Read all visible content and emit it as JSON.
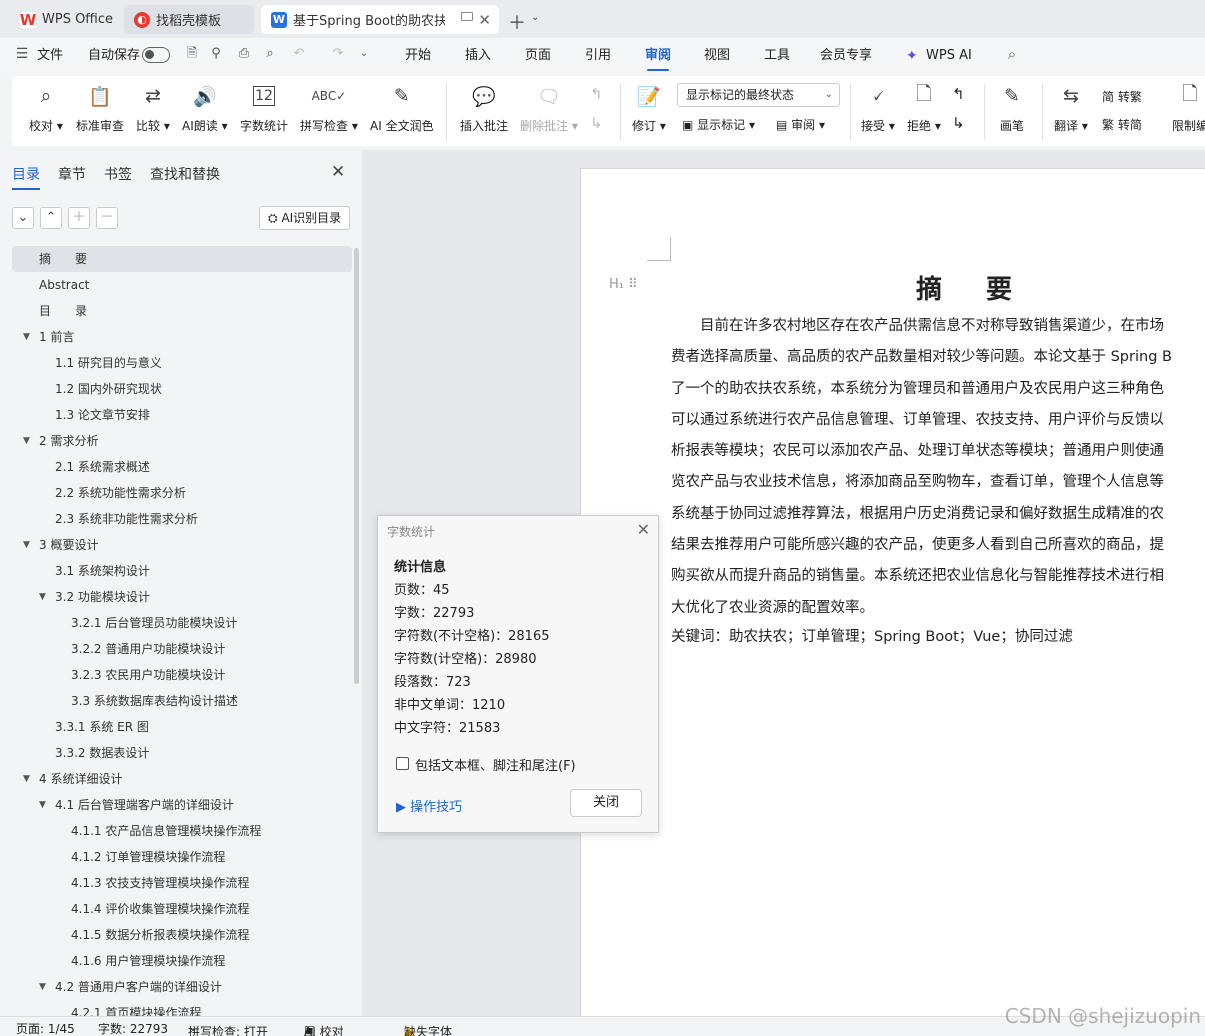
{
  "tabs": [
    {
      "label": "WPS Office",
      "icon": "wps-logo-icon",
      "color": "#e8382f"
    },
    {
      "label": "找稻壳模板",
      "icon": "docer-icon",
      "color": "#e8382f"
    },
    {
      "label": "基于Spring Boot的助农扶农",
      "icon": "word-doc-icon",
      "color": "#2b6fe0"
    }
  ],
  "menu": {
    "file": "文件",
    "autosave": "自动保存",
    "items": [
      "开始",
      "插入",
      "页面",
      "引用",
      "审阅",
      "视图",
      "工具",
      "会员专享",
      "WPS AI"
    ],
    "selected": "审阅"
  },
  "ribbon": {
    "proofread": "校对",
    "std_review": "标准审查",
    "compare": "比较",
    "ai_read": "AI朗读",
    "word_count": "字数统计",
    "spell_check": "拼写检查",
    "ai_polish": "AI 全文润色",
    "insert_comment": "插入批注",
    "delete_comment": "删除批注",
    "revise": "修订",
    "markup_state": "显示标记的最终状态",
    "show_markup": "显示标记",
    "review_pane": "审阅",
    "accept": "接受",
    "reject": "拒绝",
    "pen": "画笔",
    "translate": "翻译",
    "to_trad": "简 转繁",
    "to_simp": "繁 转简",
    "restrict": "限制编"
  },
  "nav": {
    "tabs": [
      "目录",
      "章节",
      "书签",
      "查找和替换"
    ],
    "ai_toc": "AI识别目录",
    "items": [
      {
        "label": "摘　　要",
        "level": 0,
        "selected": true
      },
      {
        "label": "Abstract",
        "level": 0
      },
      {
        "label": "目　　录",
        "level": 0
      },
      {
        "label": "1  前言",
        "level": 0,
        "expand": true
      },
      {
        "label": "1.1  研究目的与意义",
        "level": 1
      },
      {
        "label": "1.2  国内外研究现状",
        "level": 1
      },
      {
        "label": "1.3  论文章节安排",
        "level": 1
      },
      {
        "label": "2  需求分析",
        "level": 0,
        "expand": true
      },
      {
        "label": "2.1  系统需求概述",
        "level": 1
      },
      {
        "label": "2.2  系统功能性需求分析",
        "level": 1
      },
      {
        "label": "2.3  系统非功能性需求分析",
        "level": 1
      },
      {
        "label": "3  概要设计",
        "level": 0,
        "expand": true
      },
      {
        "label": "3.1  系统架构设计",
        "level": 1
      },
      {
        "label": "3.2  功能模块设计",
        "level": 1,
        "expand": true
      },
      {
        "label": "3.2.1  后台管理员功能模块设计",
        "level": 2
      },
      {
        "label": "3.2.2  普通用户功能模块设计",
        "level": 2
      },
      {
        "label": "3.2.3  农民用户功能模块设计",
        "level": 2
      },
      {
        "label": "3.3  系统数据库表结构设计描述",
        "level": 2
      },
      {
        "label": "3.3.1  系统 ER 图",
        "level": 1
      },
      {
        "label": "3.3.2  数据表设计",
        "level": 1
      },
      {
        "label": "4  系统详细设计",
        "level": 0,
        "expand": true
      },
      {
        "label": "4.1  后台管理端客户端的详细设计",
        "level": 1,
        "expand": true
      },
      {
        "label": "4.1.1  农产品信息管理模块操作流程",
        "level": 2
      },
      {
        "label": "4.1.2  订单管理模块操作流程",
        "level": 2
      },
      {
        "label": "4.1.3  农技支持管理模块操作流程",
        "level": 2
      },
      {
        "label": "4.1.4  评价收集管理模块操作流程",
        "level": 2
      },
      {
        "label": "4.1.5  数据分析报表模块操作流程",
        "level": 2
      },
      {
        "label": "4.1.6  用户管理模块操作流程",
        "level": 2
      },
      {
        "label": "4.2  普通用户客户端的详细设计",
        "level": 1,
        "expand": true
      },
      {
        "label": "4.2.1  首页模块操作流程",
        "level": 2
      }
    ]
  },
  "document": {
    "heading_mark": "H₁",
    "title": "摘要",
    "lines": [
      "　　目前在许多农村地区存在农产品供需信息不对称导致销售渠道少，在市场",
      "费者选择高质量、高品质的农产品数量相对较少等问题。本论文基于 Spring B",
      "了一个的助农扶农系统，本系统分为管理员和普通用户及农民用户这三种角色",
      "可以通过系统进行农产品信息管理、订单管理、农技支持、用户评价与反馈以",
      "析报表等模块；农民可以添加农产品、处理订单状态等模块；普通用户则使通",
      "览农产品与农业技术信息，将添加商品至购物车，查看订单，管理个人信息等",
      "系统基于协同过滤推荐算法，根据用户历史消费记录和偏好数据生成精准的农",
      "结果去推荐用户可能所感兴趣的农产品，使更多人看到自己所喜欢的商品，提",
      "购买欲从而提升商品的销售量。本系统还把农业信息化与智能推荐技术进行相",
      "大优化了农业资源的配置效率。"
    ],
    "keywords": "关键词：助农扶农；订单管理；Spring Boot；Vue；协同过滤"
  },
  "dialog": {
    "title": "字数统计",
    "heading": "统计信息",
    "rows": [
      "页数：45",
      "字数：22793",
      "字符数(不计空格)：28165",
      "字符数(计空格)：28980",
      "段落数：723",
      "非中文单词：1210",
      "中文字符：21583"
    ],
    "checkbox": "包括文本框、脚注和尾注(F)",
    "tips": "操作技巧",
    "close": "关闭"
  },
  "status": {
    "page": "页面: 1/45",
    "words": "字数: 22793",
    "spell": "拼写检查: 打开",
    "ai_proof": "AI 校对",
    "missing_font": "缺失字体"
  },
  "watermark": "CSDN @shejizuopin"
}
